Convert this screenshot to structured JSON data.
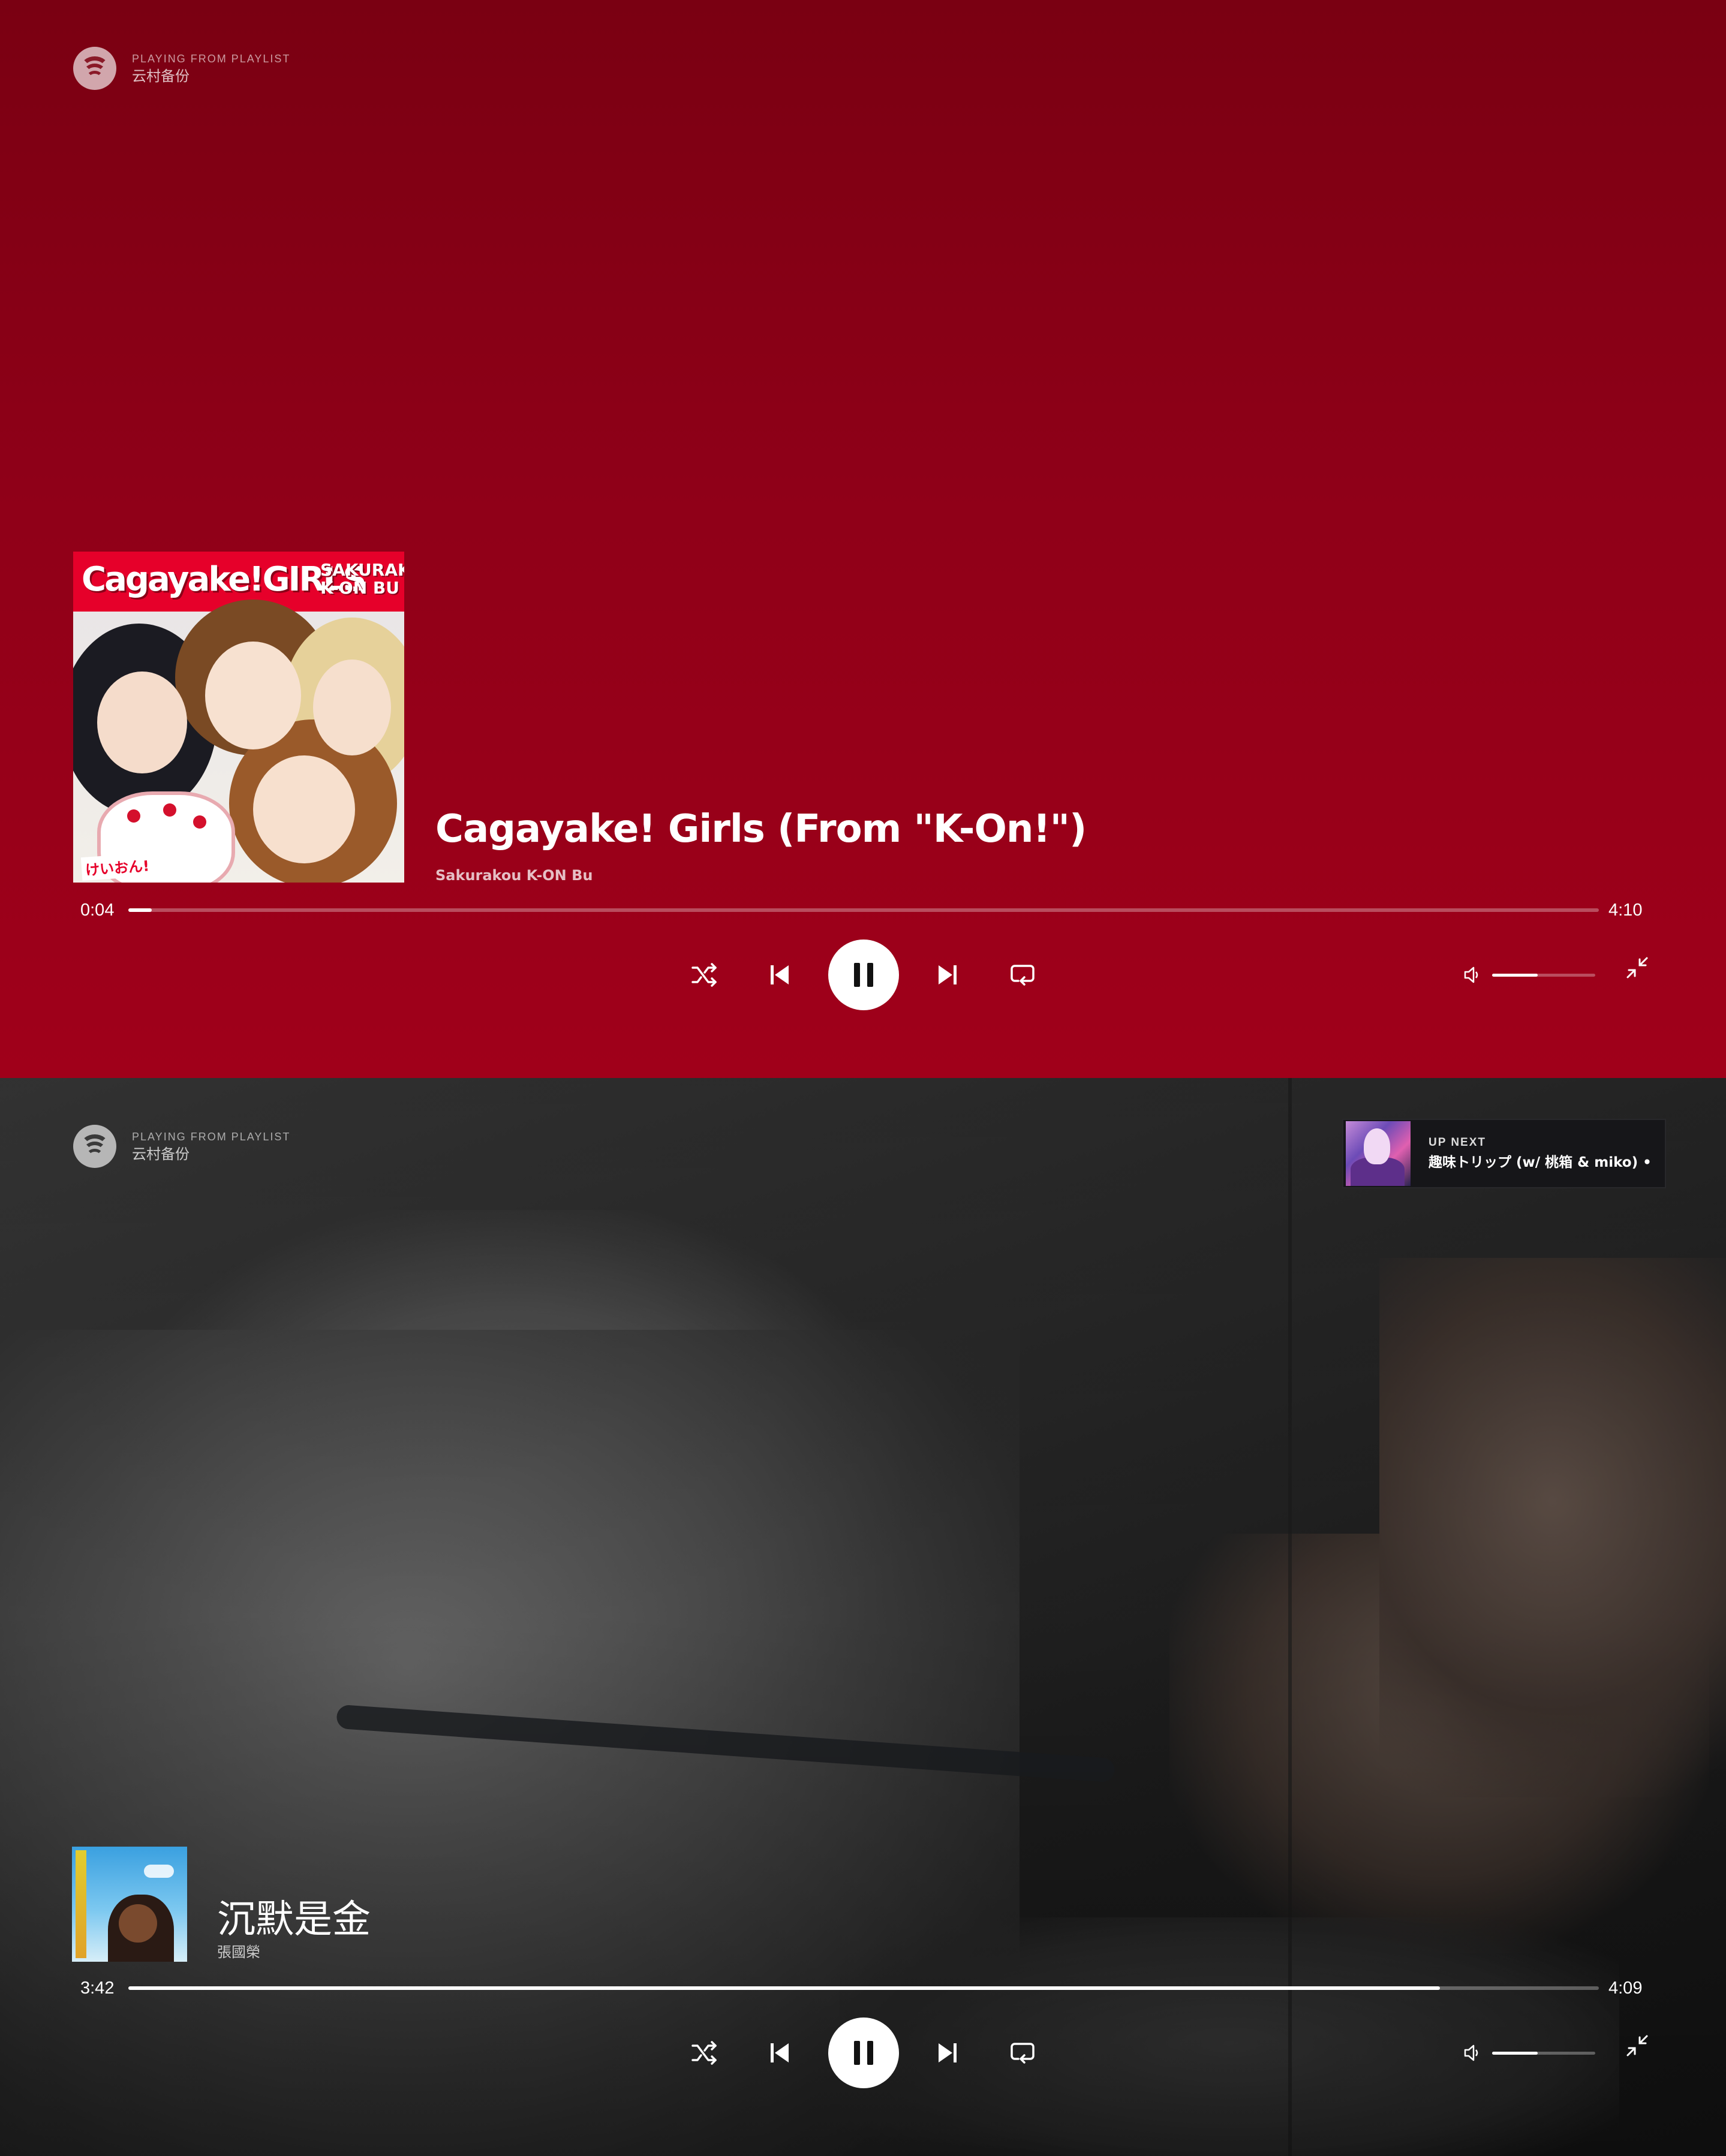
{
  "panels": [
    {
      "header": {
        "label": "PLAYING FROM PLAYLIST",
        "playlist": "云村备份"
      },
      "track": {
        "title": "Cagayake! Girls (From \"K-On!\")",
        "artist": "Sakurakou K-ON Bu",
        "album_art_text": {
          "title": "Cagayake!GIRLS",
          "subtitle_line1": "SAKURAKOU",
          "subtitle_line2": "K-ON BU",
          "logo": "けいおん!"
        }
      },
      "progress": {
        "elapsed": "0:04",
        "total": "4:10",
        "fraction": 0.016
      },
      "volume": {
        "fraction": 0.44
      },
      "background": "#8f0018",
      "icons": [
        "spotify-icon",
        "shuffle-icon",
        "previous-icon",
        "pause-icon",
        "next-icon",
        "repeat-icon",
        "volume-icon",
        "minimize-icon"
      ]
    },
    {
      "header": {
        "label": "PLAYING FROM PLAYLIST",
        "playlist": "云村备份"
      },
      "up_next": {
        "label": "UP NEXT",
        "track": "趣味トリップ (w/ 桃箱 & miko) •"
      },
      "track": {
        "title": "沉默是金",
        "artist": "張國榮"
      },
      "progress": {
        "elapsed": "3:42",
        "total": "4:09",
        "fraction": 0.892
      },
      "volume": {
        "fraction": 0.44
      },
      "background": "#2a2a2a",
      "icons": [
        "spotify-icon",
        "shuffle-icon",
        "previous-icon",
        "pause-icon",
        "next-icon",
        "repeat-icon",
        "volume-icon",
        "minimize-icon"
      ]
    }
  ]
}
